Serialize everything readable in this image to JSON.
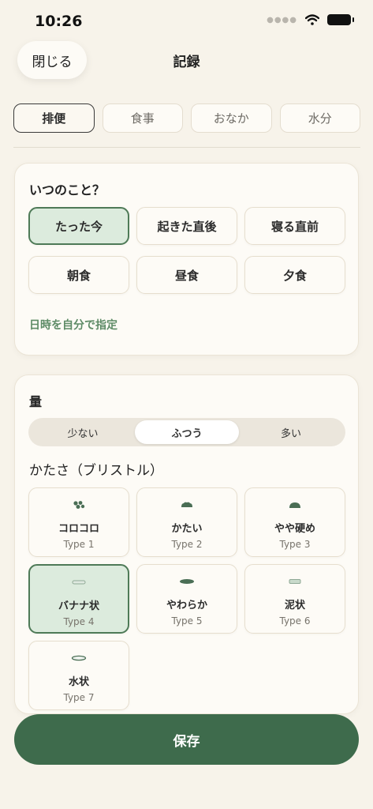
{
  "status": {
    "time": "10:26"
  },
  "header": {
    "close_label": "閉じる",
    "title": "記録"
  },
  "tabs": [
    {
      "label": "排便",
      "active": true
    },
    {
      "label": "食事",
      "active": false
    },
    {
      "label": "おなか",
      "active": false
    },
    {
      "label": "水分",
      "active": false
    }
  ],
  "when": {
    "heading": "いつのこと？",
    "options": [
      "たった今",
      "起きた直後",
      "寝る直前",
      "朝食",
      "昼食",
      "夕食"
    ],
    "selected": "たった今",
    "custom_link": "日時を自分で指定"
  },
  "amount": {
    "heading": "量",
    "options": [
      "少ない",
      "ふつう",
      "多い"
    ],
    "selected": "ふつう"
  },
  "bristol": {
    "heading": "かたさ（ブリストル）",
    "items": [
      {
        "name": "コロコロ",
        "type": "Type 1",
        "icon": "pellets-icon"
      },
      {
        "name": "かたい",
        "type": "Type 2",
        "icon": "lumpy-icon"
      },
      {
        "name": "やや硬め",
        "type": "Type 3",
        "icon": "cracked-icon"
      },
      {
        "name": "バナナ状",
        "type": "Type 4",
        "icon": "smooth-icon"
      },
      {
        "name": "やわらか",
        "type": "Type 5",
        "icon": "soft-icon"
      },
      {
        "name": "泥状",
        "type": "Type 6",
        "icon": "mushy-icon"
      },
      {
        "name": "水状",
        "type": "Type 7",
        "icon": "watery-icon"
      }
    ],
    "selected_index": 3
  },
  "footer": {
    "save_label": "保存"
  },
  "colors": {
    "accent": "#3e6b4c",
    "selected_bg": "#dcebdd",
    "selected_border": "#4e7a57",
    "background": "#f7f3ea"
  }
}
